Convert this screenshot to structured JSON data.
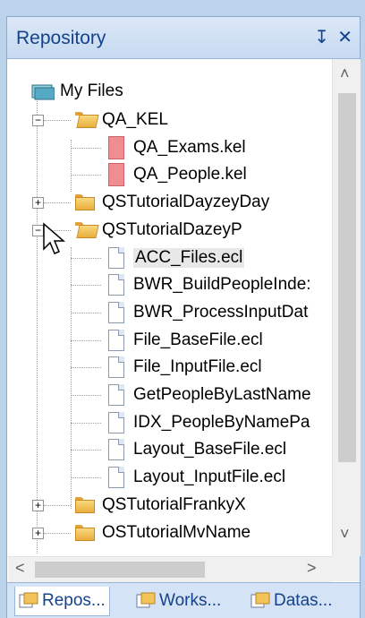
{
  "panel": {
    "title": "Repository",
    "pin_glyph": "↧",
    "close_glyph": "✕"
  },
  "tree": {
    "root": "My Files",
    "items": [
      {
        "label": "QA_KEL",
        "kind": "folder-open",
        "expander": "−"
      },
      {
        "label": "QA_Exams.kel",
        "kind": "kel-file"
      },
      {
        "label": "QA_People.kel",
        "kind": "kel-file"
      },
      {
        "label": "QSTutorialDayzeyDay",
        "kind": "folder",
        "expander": "+"
      },
      {
        "label": "QSTutorialDazeyP",
        "kind": "folder-open",
        "expander": "−"
      },
      {
        "label": "ACC_Files.ecl",
        "kind": "ecl-file"
      },
      {
        "label": "BWR_BuildPeopleInde:",
        "kind": "ecl-file"
      },
      {
        "label": "BWR_ProcessInputDat",
        "kind": "ecl-file"
      },
      {
        "label": "File_BaseFile.ecl",
        "kind": "ecl-file"
      },
      {
        "label": "File_InputFile.ecl",
        "kind": "ecl-file"
      },
      {
        "label": "GetPeopleByLastName",
        "kind": "ecl-file"
      },
      {
        "label": "IDX_PeopleByNamePa",
        "kind": "ecl-file"
      },
      {
        "label": "Layout_BaseFile.ecl",
        "kind": "ecl-file"
      },
      {
        "label": "Layout_InputFile.ecl",
        "kind": "ecl-file"
      },
      {
        "label": "QSTutorialFrankyX",
        "kind": "folder",
        "expander": "+"
      },
      {
        "label": "OSTutorialMvName",
        "kind": "folder",
        "expander": "+"
      }
    ]
  },
  "scrollbar": {
    "up": "˄",
    "down": "˅",
    "left": "<",
    "right": ">"
  },
  "tabs": [
    {
      "label": "Repos..."
    },
    {
      "label": "Works..."
    },
    {
      "label": "Datas..."
    }
  ],
  "colors": {
    "accent": "#15428b",
    "kel_file": "#ef8d93",
    "folder": "#f9d97d"
  }
}
